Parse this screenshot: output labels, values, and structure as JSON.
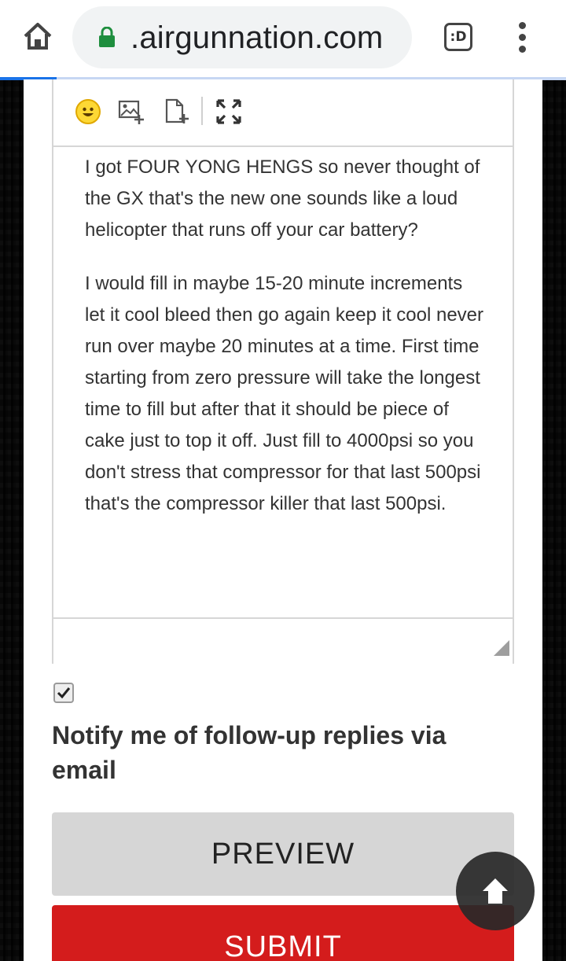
{
  "browser": {
    "url": ".airgunnation.com",
    "tabs_label": ":D",
    "load_progress": 0.1
  },
  "editor": {
    "toolbar": {
      "icons": [
        "smiley-emoji-icon",
        "insert-image-icon",
        "attach-file-icon",
        "fullscreen-icon"
      ]
    },
    "paragraphs": [
      "I got FOUR YONG HENGS so never thought of the GX that's the new one sounds like a loud helicopter that runs off your car battery?",
      "I would fill in maybe 15-20 minute increments let it cool bleed then go again keep it cool never run over maybe 20 minutes at a time. First time starting from zero pressure will take the longest time to fill but after that it should be piece of cake just to top it off. Just fill to 4000psi so you don't stress that compressor for that last 500psi that's the compressor killer that last 500psi."
    ]
  },
  "notify": {
    "checked": true,
    "label": "Notify me of follow-up replies via email"
  },
  "buttons": {
    "preview": "PREVIEW",
    "submit": "SUBMIT"
  },
  "colors": {
    "submit_bg": "#d41c1c",
    "preview_bg": "#d6d6d6",
    "progress": "#1a73e8",
    "lock": "#1e8e3e"
  }
}
